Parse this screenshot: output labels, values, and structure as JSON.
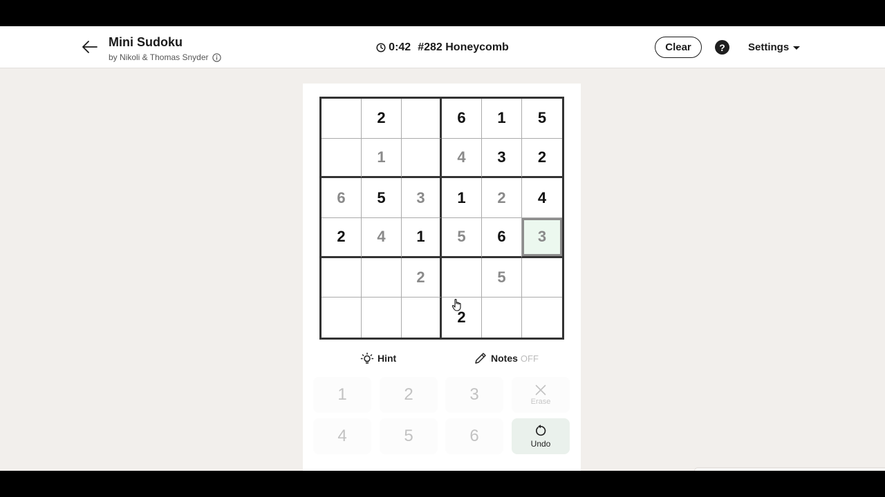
{
  "header": {
    "title": "Mini Sudoku",
    "byline": "by Nikoli & Thomas Snyder",
    "timer": "0:42",
    "puzzle_name": "#282 Honeycomb",
    "clear_label": "Clear",
    "help_label": "?",
    "settings_label": "Settings"
  },
  "grid": {
    "rows": [
      [
        {
          "v": ""
        },
        {
          "v": "2",
          "t": "given"
        },
        {
          "v": ""
        },
        {
          "v": "6",
          "t": "given"
        },
        {
          "v": "1",
          "t": "given"
        },
        {
          "v": "5",
          "t": "given"
        }
      ],
      [
        {
          "v": ""
        },
        {
          "v": "1",
          "t": "entered"
        },
        {
          "v": ""
        },
        {
          "v": "4",
          "t": "entered"
        },
        {
          "v": "3",
          "t": "given"
        },
        {
          "v": "2",
          "t": "given"
        }
      ],
      [
        {
          "v": "6",
          "t": "entered"
        },
        {
          "v": "5",
          "t": "given"
        },
        {
          "v": "3",
          "t": "entered"
        },
        {
          "v": "1",
          "t": "given"
        },
        {
          "v": "2",
          "t": "entered"
        },
        {
          "v": "4",
          "t": "given"
        }
      ],
      [
        {
          "v": "2",
          "t": "given"
        },
        {
          "v": "4",
          "t": "entered"
        },
        {
          "v": "1",
          "t": "given"
        },
        {
          "v": "5",
          "t": "entered"
        },
        {
          "v": "6",
          "t": "given"
        },
        {
          "v": "3",
          "t": "entered",
          "selected": true
        }
      ],
      [
        {
          "v": ""
        },
        {
          "v": ""
        },
        {
          "v": "2",
          "t": "entered"
        },
        {
          "v": ""
        },
        {
          "v": "5",
          "t": "entered"
        },
        {
          "v": ""
        }
      ],
      [
        {
          "v": ""
        },
        {
          "v": ""
        },
        {
          "v": ""
        },
        {
          "v": "2",
          "t": "given"
        },
        {
          "v": ""
        },
        {
          "v": ""
        }
      ]
    ]
  },
  "tools": {
    "hint_label": "Hint",
    "notes_label": "Notes",
    "notes_state": "OFF"
  },
  "numpad": {
    "keys": [
      "1",
      "2",
      "3",
      "4",
      "5",
      "6"
    ],
    "erase_label": "Erase",
    "undo_label": "Undo"
  },
  "colors": {
    "given": "#111111",
    "entered": "#8a8a8a",
    "selected_bg": "#ecf8ef",
    "undo_bg": "#eaf1ec"
  },
  "icons": {
    "back": "arrow-left-icon",
    "info": "info-icon",
    "clock": "clock-icon",
    "hint": "lightbulb-icon",
    "notes": "pencil-icon",
    "erase": "x-icon",
    "undo": "rotate-ccw-icon"
  }
}
